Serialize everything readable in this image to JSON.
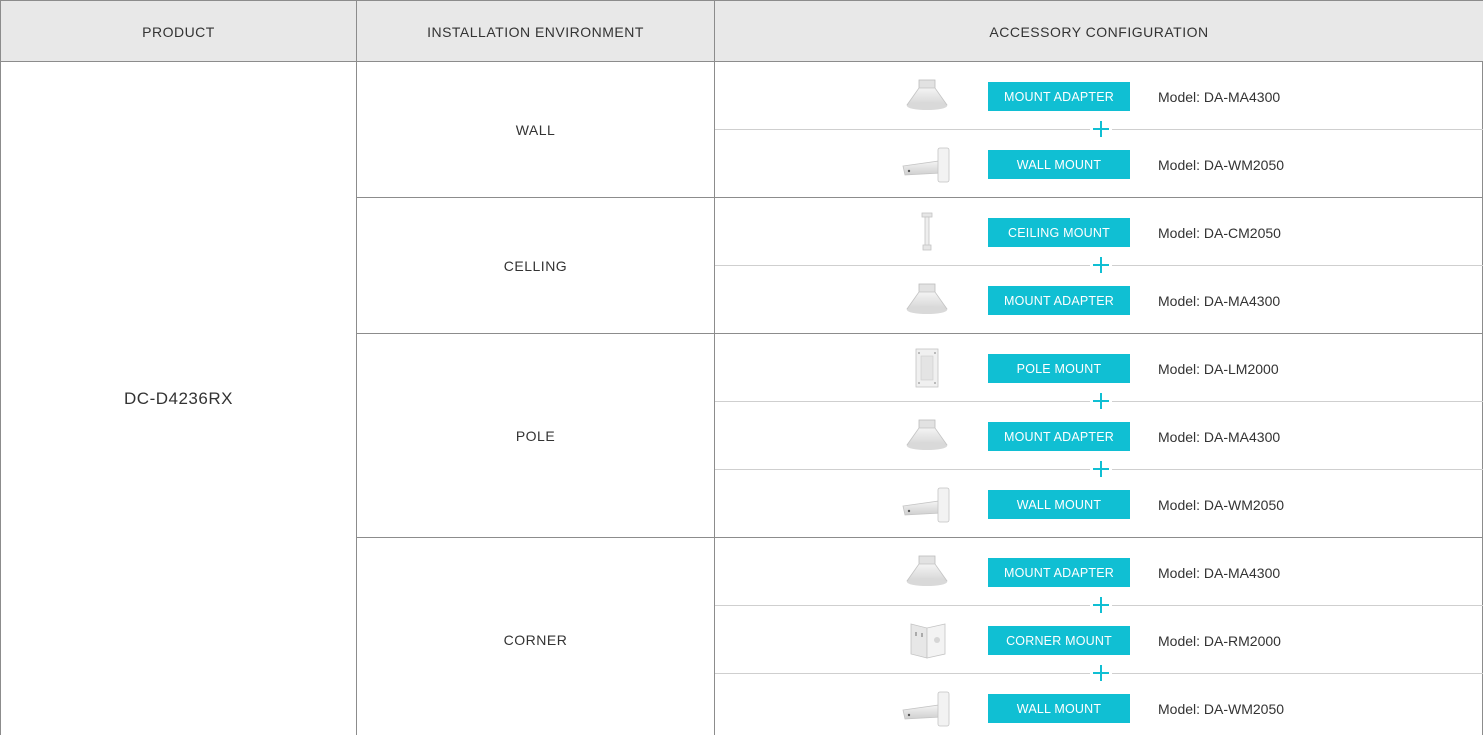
{
  "header": {
    "product": "PRODUCT",
    "environment": "INSTALLATION ENVIRONMENT",
    "accessory": "ACCESSORY CONFIGURATION"
  },
  "product": "DC-D4236RX",
  "accent_color": "#10bfd3",
  "groups": [
    {
      "environment": "WALL",
      "items": [
        {
          "label": "MOUNT ADAPTER",
          "model": "Model: DA-MA4300",
          "icon": "mount-adapter-icon"
        },
        {
          "label": "WALL MOUNT",
          "model": "Model: DA-WM2050",
          "icon": "wall-mount-icon"
        }
      ]
    },
    {
      "environment": "CELLING",
      "items": [
        {
          "label": "CEILING MOUNT",
          "model": "Model: DA-CM2050",
          "icon": "ceiling-mount-icon"
        },
        {
          "label": "MOUNT ADAPTER",
          "model": "Model: DA-MA4300",
          "icon": "mount-adapter-icon"
        }
      ]
    },
    {
      "environment": "POLE",
      "items": [
        {
          "label": "POLE MOUNT",
          "model": "Model: DA-LM2000",
          "icon": "pole-mount-icon"
        },
        {
          "label": "MOUNT ADAPTER",
          "model": "Model: DA-MA4300",
          "icon": "mount-adapter-icon"
        },
        {
          "label": "WALL MOUNT",
          "model": "Model: DA-WM2050",
          "icon": "wall-mount-icon"
        }
      ]
    },
    {
      "environment": "CORNER",
      "items": [
        {
          "label": "MOUNT ADAPTER",
          "model": "Model: DA-MA4300",
          "icon": "mount-adapter-icon"
        },
        {
          "label": "CORNER MOUNT",
          "model": "Model: DA-RM2000",
          "icon": "corner-mount-icon"
        },
        {
          "label": "WALL MOUNT",
          "model": "Model: DA-WM2050",
          "icon": "wall-mount-icon"
        }
      ]
    }
  ]
}
